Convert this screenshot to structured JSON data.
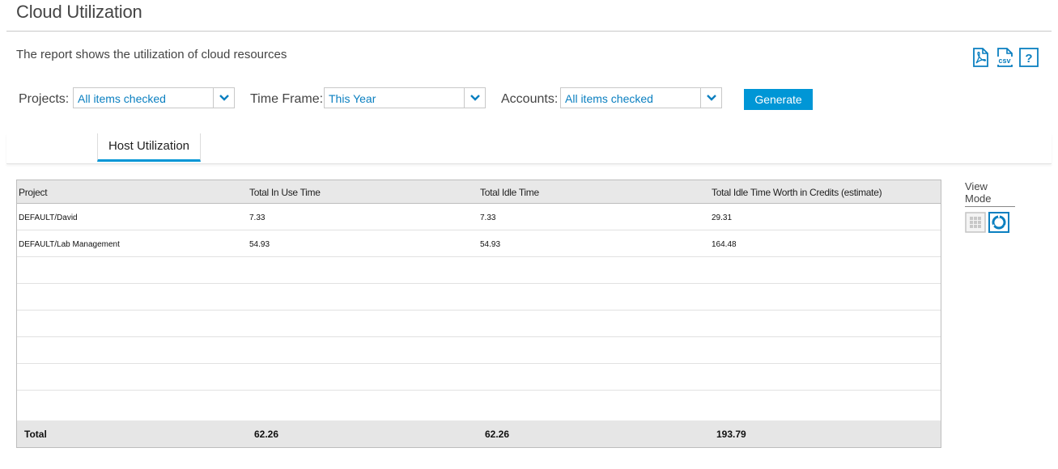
{
  "page": {
    "title": "Cloud Utilization",
    "description": "The report shows the utilization of cloud resources"
  },
  "exports": {
    "pdf_icon": "pdf-export-icon",
    "csv_icon": "csv-export-icon",
    "csv_label": "csv",
    "help_icon": "help-icon",
    "help_label": "?"
  },
  "filters": {
    "projects": {
      "label": "Projects:",
      "value": "All items checked"
    },
    "time_frame": {
      "label": "Time Frame:",
      "value": "This Year"
    },
    "accounts": {
      "label": "Accounts:",
      "value": "All items checked"
    },
    "generate_label": "Generate"
  },
  "tabs": [
    {
      "label": "Host Utilization",
      "active": true
    }
  ],
  "table": {
    "columns": [
      "Project",
      "Total In Use Time",
      "Total Idle Time",
      "Total Idle Time Worth in Credits (estimate)"
    ],
    "rows": [
      [
        "DEFAULT/David",
        "7.33",
        "7.33",
        "29.31"
      ],
      [
        "DEFAULT/Lab Management",
        "54.93",
        "54.93",
        "164.48"
      ]
    ],
    "total": [
      "Total",
      "62.26",
      "62.26",
      "193.79"
    ]
  },
  "view_mode": {
    "label": "View Mode",
    "grid_icon": "grid-view-icon",
    "chart_icon": "donut-chart-view-icon"
  },
  "colors": {
    "accent": "#0096d6",
    "select_text": "#0a7fc0",
    "header_bg": "#e8e8e8"
  }
}
